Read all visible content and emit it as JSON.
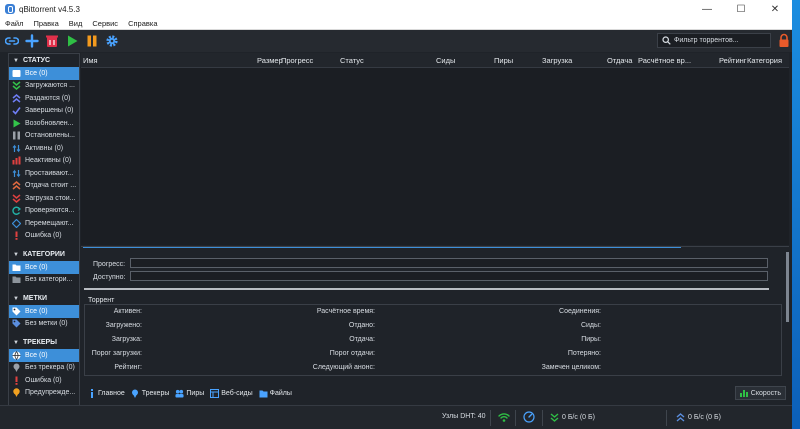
{
  "window": {
    "title": "qBittorrent v4.5.3",
    "minimize": "—",
    "maximize": "☐",
    "close": "✕"
  },
  "menu": [
    "Файл",
    "Правка",
    "Вид",
    "Сервис",
    "Справка"
  ],
  "toolbar": {
    "icons": [
      "link-icon",
      "add-torrent-icon",
      "remove-icon",
      "resume-icon",
      "pause-icon",
      "gear-icon"
    ],
    "filter_placeholder": "Фильтр торрентов..."
  },
  "sidebar": {
    "status": {
      "title": "СТАТУС",
      "items": [
        {
          "label": "Все (0)",
          "icon": "all-icon",
          "selected": true,
          "color": "#5bb0ff"
        },
        {
          "label": "Загружаются ...",
          "icon": "download-icon",
          "selected": false,
          "color": "#33c44a"
        },
        {
          "label": "Раздаются (0)",
          "icon": "upload-icon",
          "selected": false,
          "color": "#6f7ef5"
        },
        {
          "label": "Завершены (0)",
          "icon": "check-icon",
          "selected": false,
          "color": "#6f7ef5"
        },
        {
          "label": "Возобновлен...",
          "icon": "play-icon",
          "selected": false,
          "color": "#33c44a"
        },
        {
          "label": "Остановлены...",
          "icon": "pause-icon",
          "selected": false,
          "color": "#9aa0a8"
        },
        {
          "label": "Активны (0)",
          "icon": "active-icon",
          "selected": false,
          "color": "#3d8fd9"
        },
        {
          "label": "Неактивны (0)",
          "icon": "inactive-icon",
          "selected": false,
          "color": "#e04040"
        },
        {
          "label": "Простаивают...",
          "icon": "stalled-icon",
          "selected": false,
          "color": "#3d8fd9"
        },
        {
          "label": "Отдача стоит ...",
          "icon": "stalled-upload-icon",
          "selected": false,
          "color": "#e06a40"
        },
        {
          "label": "Загрузка стои...",
          "icon": "stalled-download-icon",
          "selected": false,
          "color": "#e04040"
        },
        {
          "label": "Проверяются...",
          "icon": "checking-icon",
          "selected": false,
          "color": "#22b3a8"
        },
        {
          "label": "Перемещают...",
          "icon": "moving-icon",
          "selected": false,
          "color": "#3d8fd9"
        },
        {
          "label": "Ошибка (0)",
          "icon": "error-icon",
          "selected": false,
          "color": "#e04040"
        }
      ]
    },
    "categories": {
      "title": "КАТЕГОРИИ",
      "items": [
        {
          "label": "Все (0)",
          "icon": "folder-icon",
          "selected": true,
          "color": "#5bb0ff"
        },
        {
          "label": "Без категори...",
          "icon": "folder-icon",
          "selected": false,
          "color": "#8d949c"
        }
      ]
    },
    "tags": {
      "title": "МЕТКИ",
      "items": [
        {
          "label": "Все (0)",
          "icon": "tag-icon",
          "selected": true,
          "color": "#5bb0ff"
        },
        {
          "label": "Без метки (0)",
          "icon": "tag-icon",
          "selected": false,
          "color": "#5b8fe0"
        }
      ]
    },
    "trackers": {
      "title": "ТРЕКЕРЫ",
      "items": [
        {
          "label": "Все (0)",
          "icon": "globe-icon",
          "selected": true,
          "color": "#5bb0ff"
        },
        {
          "label": "Без трекера (0)",
          "icon": "pin-icon",
          "selected": false,
          "color": "#9aa0a8"
        },
        {
          "label": "Ошибка (0)",
          "icon": "error-icon",
          "selected": false,
          "color": "#e04040"
        },
        {
          "label": "Предупрежде...",
          "icon": "warning-icon",
          "selected": false,
          "color": "#f0a020"
        }
      ]
    }
  },
  "columns": [
    "Имя",
    "Размер",
    "Прогресс",
    "Статус",
    "Сиды",
    "Пиры",
    "Загрузка",
    "Отдача",
    "Расчётное вр...",
    "Рейтинг",
    "Категория"
  ],
  "properties": {
    "progress_label": "Прогресс:",
    "availability_label": "Доступно:",
    "torrent_title": "Торрент",
    "col1": [
      "Активен:",
      "Загружено:",
      "Загрузка:",
      "Порог загрузки:",
      "Рейтинг:"
    ],
    "col2": [
      "Расчётное время:",
      "Отдано:",
      "Отдача:",
      "Порог отдачи:",
      "Следующий анонс:"
    ],
    "col3": [
      "Соединения:",
      "Сиды:",
      "Пиры:",
      "Потеряно:",
      "Замечен целиком:"
    ]
  },
  "tabs": [
    {
      "label": "Главное",
      "icon": "info-icon"
    },
    {
      "label": "Трекеры",
      "icon": "tracker-icon"
    },
    {
      "label": "Пиры",
      "icon": "peers-icon"
    },
    {
      "label": "Веб-сиды",
      "icon": "webseed-icon"
    },
    {
      "label": "Файлы",
      "icon": "files-icon"
    }
  ],
  "speed_button": "Скорость",
  "status": {
    "dht": "Узлы DHT: 40",
    "download": "0 Б/с (0 Б)",
    "upload": "0 Б/с (0 Б)"
  },
  "colors": {
    "accent": "#3d8fd9",
    "background": "#1f2329",
    "list_background": "#1b1e23"
  }
}
